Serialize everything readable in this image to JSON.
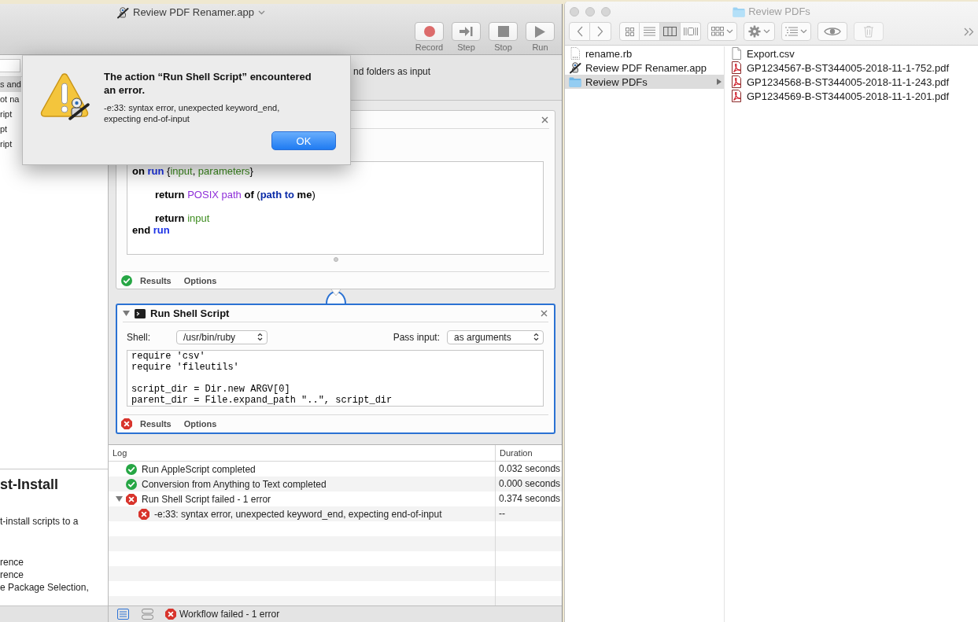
{
  "automator": {
    "title": "Review PDF Renamer.app",
    "toolbar": [
      {
        "kind": "record",
        "label": "Record"
      },
      {
        "kind": "step",
        "label": "Step"
      },
      {
        "kind": "stop",
        "label": "Stop"
      },
      {
        "kind": "run",
        "label": "Run"
      }
    ],
    "library": {
      "items": [
        {
          "label": "s and",
          "selected": true
        },
        {
          "label": "ot na",
          "selected": false
        },
        {
          "label": "ript",
          "selected": false
        },
        {
          "label": "pt",
          "selected": false
        },
        {
          "label": "ript",
          "selected": false
        }
      ],
      "description": {
        "title": "st-Install",
        "paragraphs": [
          {
            "lines": [
              "t-install scripts to a"
            ]
          },
          {
            "lines": [
              "rence",
              "rence",
              "e Package Selection,"
            ]
          }
        ]
      }
    },
    "workflow_header": "nd folders as input",
    "actions": [
      {
        "kind": "applescript",
        "selected": false,
        "expanded": true,
        "failed": false,
        "code": [
          {
            "kind": "keyword",
            "text": "on "
          },
          {
            "kind": "handler",
            "text": "run"
          },
          {
            "kind": "plain",
            "text": " {"
          },
          {
            "kind": "variable",
            "text": "input"
          },
          {
            "kind": "plain",
            "text": ", "
          },
          {
            "kind": "variable",
            "text": "parameters"
          },
          {
            "kind": "plain",
            "text": "}\n\n\t"
          },
          {
            "kind": "keyword",
            "text": "return "
          },
          {
            "kind": "property",
            "text": "POSIX path "
          },
          {
            "kind": "keyword",
            "text": "of"
          },
          {
            "kind": "plain",
            "text": " ("
          },
          {
            "kind": "command",
            "text": "path to "
          },
          {
            "kind": "keyword",
            "text": "me"
          },
          {
            "kind": "plain",
            "text": ")\n\n\t"
          },
          {
            "kind": "keyword",
            "text": "return "
          },
          {
            "kind": "variable",
            "text": "input"
          },
          {
            "kind": "keyword",
            "text": "\nend "
          },
          {
            "kind": "handler",
            "text": "run"
          }
        ],
        "footer": [
          "Results",
          "Options"
        ]
      },
      {
        "kind": "shell",
        "selected": true,
        "expanded": true,
        "failed": true,
        "title": "Run Shell Script",
        "shell": {
          "label": "Shell:",
          "value": "/usr/bin/ruby"
        },
        "pass_input": {
          "label": "Pass input:",
          "value": "as arguments"
        },
        "code": "require 'csv'\nrequire 'fileutils'\n\nscript_dir = Dir.new ARGV[0]\nparent_dir = File.expand_path \"..\", script_dir",
        "footer": [
          "Results",
          "Options"
        ]
      }
    ],
    "log": {
      "columns": [
        "Log",
        "Duration"
      ],
      "rows": [
        {
          "failed": false,
          "message": "Run AppleScript completed",
          "duration": "0.032 seconds"
        },
        {
          "failed": false,
          "message": "Conversion from Anything to Text completed",
          "duration": "0.000 seconds"
        },
        {
          "failed": true,
          "expanded": true,
          "message": "Run Shell Script failed - 1 error",
          "duration": "0.374 seconds",
          "children": [
            {
              "failed": true,
              "message": "-e:33: syntax error, unexpected keyword_end, expecting end-of-input",
              "duration": "--"
            }
          ]
        }
      ]
    },
    "status_bar": {
      "views": [
        {
          "kind": "list",
          "selected": true
        },
        {
          "kind": "flow",
          "selected": false
        }
      ],
      "failed": true,
      "message": "Workflow failed - 1 error"
    }
  },
  "alert": {
    "title": "The action “Run Shell Script” encountered an error.",
    "message": "-e:33: syntax error, unexpected keyword_end, expecting end-of-input",
    "button": "OK"
  },
  "finder": {
    "title": "Review PDFs",
    "view_modes": [
      {
        "kind": "icon",
        "selected": false
      },
      {
        "kind": "list",
        "selected": false
      },
      {
        "kind": "column",
        "selected": true
      },
      {
        "kind": "gallery",
        "selected": false
      }
    ],
    "tools": [
      {
        "kind": "group",
        "disabled": false
      },
      {
        "kind": "action",
        "disabled": false
      },
      {
        "kind": "arrange",
        "disabled": false
      },
      {
        "kind": "quicklook",
        "disabled": false
      },
      {
        "kind": "trash",
        "disabled": true
      }
    ],
    "columns": [
      {
        "items": [
          {
            "kind": "script",
            "name": "rename.rb",
            "selected": false
          },
          {
            "kind": "app",
            "name": "Review PDF Renamer.app",
            "selected": false
          },
          {
            "kind": "folder",
            "name": "Review PDFs",
            "selected": true
          }
        ]
      },
      {
        "items": [
          {
            "kind": "document",
            "name": "Export.csv",
            "selected": false
          },
          {
            "kind": "pdf",
            "name": "GP1234567-B-ST344005-2018-11-1-752.pdf",
            "selected": false
          },
          {
            "kind": "pdf",
            "name": "GP1234568-B-ST344005-2018-11-1-243.pdf",
            "selected": false
          },
          {
            "kind": "pdf",
            "name": "GP1234569-B-ST344005-2018-11-1-201.pdf",
            "selected": false
          }
        ]
      }
    ]
  }
}
